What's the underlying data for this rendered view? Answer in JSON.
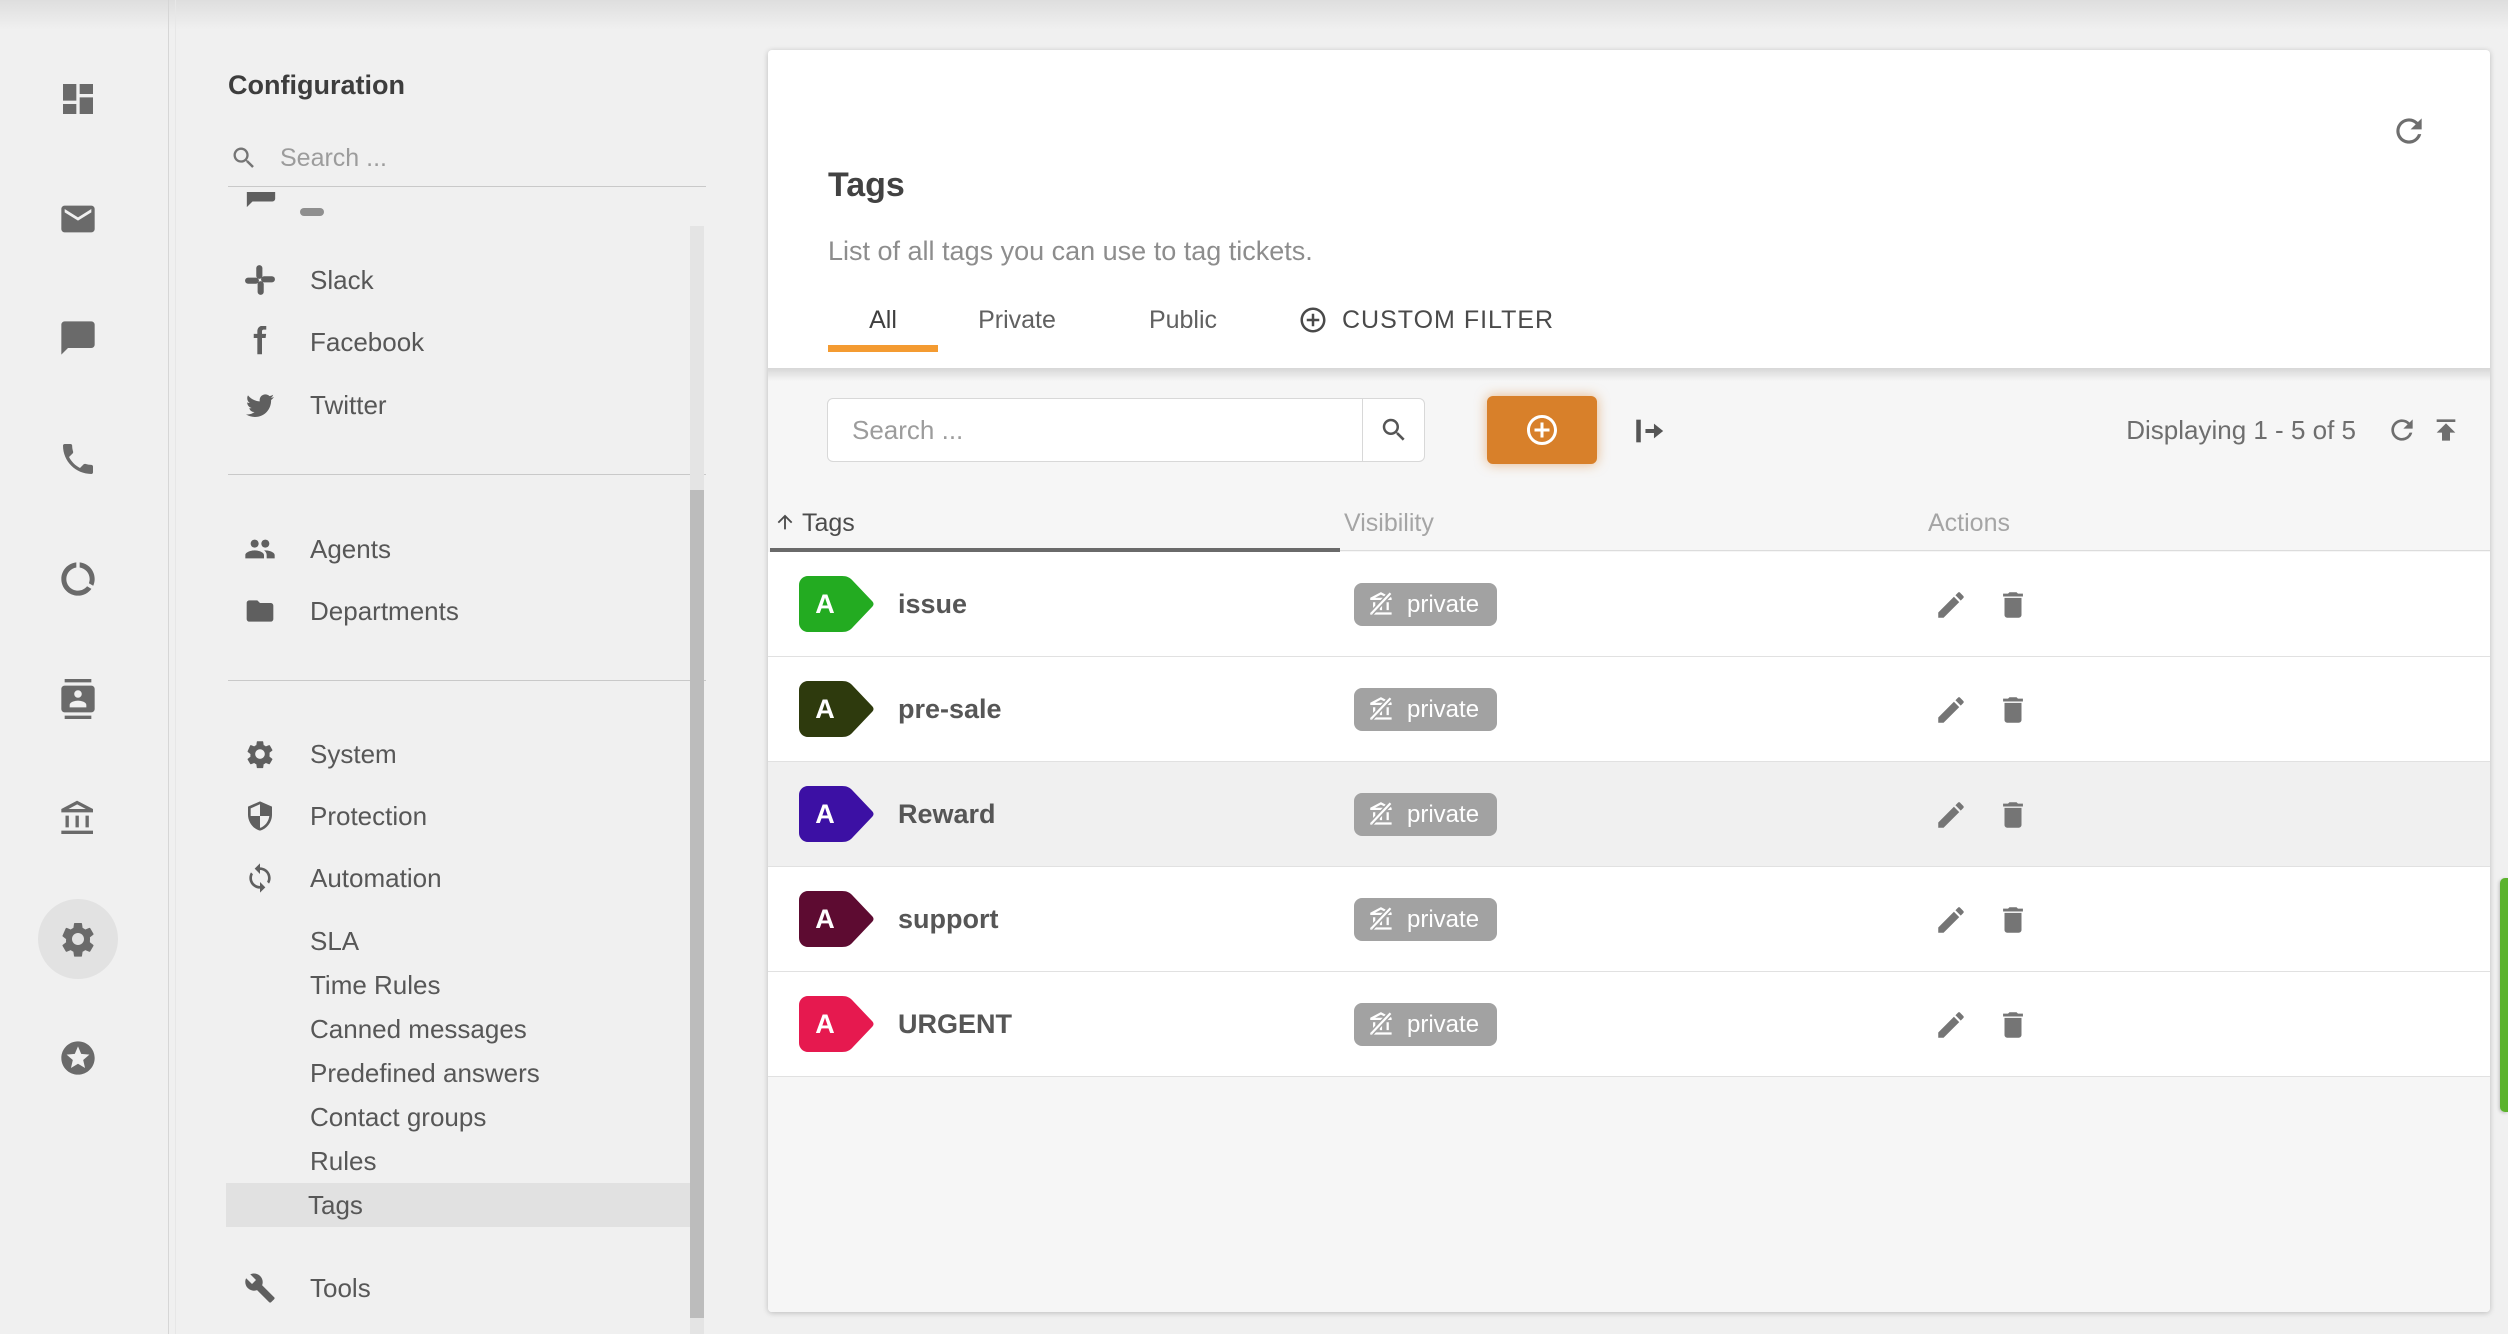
{
  "app": {
    "accent_orange": "#d8802a",
    "tab_underline_orange": "#f49b31",
    "chat_widget_green": "#5bb32c",
    "visibility_badge_gray": "#a2a2a2"
  },
  "icon_rail": {
    "items": [
      {
        "icon": "dashboard-icon"
      },
      {
        "icon": "mail-icon"
      },
      {
        "icon": "chat-icon"
      },
      {
        "icon": "phone-icon"
      },
      {
        "icon": "data-usage-icon"
      },
      {
        "icon": "contacts-icon"
      },
      {
        "icon": "bank-icon"
      },
      {
        "icon": "settings-gear-icon",
        "selected": true
      },
      {
        "icon": "star-circle-icon"
      }
    ]
  },
  "config_panel": {
    "title": "Configuration",
    "search_placeholder": "Search ...",
    "nav": {
      "channels": [
        {
          "label": "Slack",
          "icon": "slack-icon"
        },
        {
          "label": "Facebook",
          "icon": "facebook-icon"
        },
        {
          "label": "Twitter",
          "icon": "twitter-icon"
        }
      ],
      "directory": [
        {
          "label": "Agents",
          "icon": "agents-icon"
        },
        {
          "label": "Departments",
          "icon": "folder-icon"
        }
      ],
      "system_group": [
        {
          "label": "System",
          "icon": "gear-icon"
        },
        {
          "label": "Protection",
          "icon": "shield-icon"
        },
        {
          "label": "Automation",
          "icon": "loop-icon"
        }
      ],
      "sub": [
        "SLA",
        "Time Rules",
        "Canned messages",
        "Predefined answers",
        "Contact groups",
        "Rules",
        "Tags"
      ],
      "selected_item": "Tags",
      "tools": {
        "label": "Tools",
        "icon": "wrench-icon"
      }
    }
  },
  "main": {
    "title": "Tags",
    "description": "List of all tags you can use to tag tickets.",
    "header_refresh_icon": "refresh-icon",
    "tabs": [
      {
        "label": "All",
        "active": true
      },
      {
        "label": "Private"
      },
      {
        "label": "Public"
      },
      {
        "label": "CUSTOM FILTER",
        "icon": "plus-circle-icon"
      }
    ],
    "toolbar": {
      "search_placeholder": "Search ...",
      "search_icon": "search-icon",
      "add_button_icon": "plus-circle-icon",
      "export_icon": "export-icon",
      "paging_text": "Displaying 1 - 5 of 5",
      "refresh_icon": "refresh-icon",
      "upload_icon": "upload-icon"
    },
    "table": {
      "columns": [
        "Tags",
        "Visibility",
        "Actions"
      ],
      "sort_column": "Tags",
      "sort_direction": "asc",
      "tag_letter": "A",
      "row_action_icons": [
        "edit-icon",
        "delete-icon"
      ],
      "visibility_icon": "private-slash-icon",
      "rows": [
        {
          "name": "issue",
          "color": "#23ab21",
          "visibility": "private",
          "highlighted": false
        },
        {
          "name": "pre-sale",
          "color": "#2e3a0d",
          "visibility": "private",
          "highlighted": false
        },
        {
          "name": "Reward",
          "color": "#3c10a4",
          "visibility": "private",
          "highlighted": true
        },
        {
          "name": "support",
          "color": "#5d0b31",
          "visibility": "private",
          "highlighted": false
        },
        {
          "name": "URGENT",
          "color": "#e6194f",
          "visibility": "private",
          "highlighted": false
        }
      ]
    }
  }
}
